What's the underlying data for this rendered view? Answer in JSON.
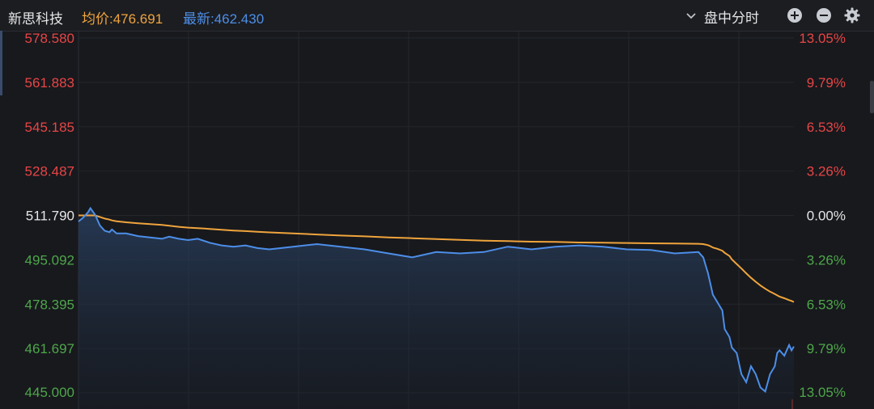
{
  "header": {
    "stock_name": "新思科技",
    "avg_price_text": "均价:476.691",
    "last_price_text": "最新:462.430",
    "mode_label": "盘中分时"
  },
  "icons": {
    "mode_dropdown": "chevron-down-icon",
    "zoom_in": "plus-circle-icon",
    "zoom_out": "minus-circle-icon",
    "settings": "gear-icon"
  },
  "colors": {
    "background": "#17191d",
    "up": "#e84545",
    "down": "#4fa64a",
    "neutral": "#e6e6e6",
    "price_line": "#4d8ee8",
    "avg_line": "#f0a43c"
  },
  "chart_data": {
    "type": "line",
    "title": "",
    "reference_price": 511.79,
    "ylim": [
      445.0,
      578.58
    ],
    "y_ticks": [
      "578.580",
      "561.883",
      "545.185",
      "528.487",
      "511.790",
      "495.092",
      "478.395",
      "461.697",
      "445.000"
    ],
    "pct_ticks": [
      "13.05%",
      "9.79%",
      "6.53%",
      "3.26%",
      "0.00%",
      "3.26%",
      "6.53%",
      "9.79%",
      "13.05%"
    ],
    "tick_sides": [
      "up",
      "up",
      "up",
      "up",
      "neutral",
      "down",
      "down",
      "down",
      "down"
    ],
    "x": [
      0,
      2,
      4,
      5,
      7,
      9,
      11,
      13,
      14,
      16,
      20,
      25,
      30,
      35,
      38,
      42,
      46,
      50,
      55,
      60,
      65,
      70,
      75,
      80,
      90,
      100,
      110,
      120,
      130,
      140,
      150,
      160,
      170,
      180,
      190,
      200,
      210,
      220,
      230,
      240,
      250,
      260,
      262,
      264,
      265,
      266,
      268,
      270,
      271,
      273,
      274,
      276,
      278,
      280,
      282,
      284,
      286,
      288,
      290,
      292,
      293,
      294,
      296,
      298,
      299,
      300
    ],
    "series": [
      {
        "values": [
          509.5,
          511.0,
          513.0,
          514.5,
          512.0,
          508.0,
          506.0,
          505.5,
          506.5,
          505.0,
          505.0,
          504.0,
          503.5,
          503.0,
          503.8,
          503.0,
          502.5,
          503.0,
          501.5,
          500.5,
          500.0,
          500.5,
          499.5,
          499.0,
          500.0,
          501.0,
          500.0,
          499.0,
          497.5,
          496.0,
          498.0,
          497.5,
          498.0,
          500.0,
          499.0,
          500.0,
          500.5,
          500.0,
          499.0,
          498.8,
          497.5,
          498.0,
          496.0,
          490.0,
          486.0,
          482.0,
          479.0,
          476.0,
          469.0,
          466.0,
          462.0,
          460.0,
          452.0,
          449.0,
          455.0,
          452.0,
          447.0,
          445.5,
          452.0,
          455.0,
          460.0,
          461.0,
          459.0,
          463.0,
          461.0,
          462.43
        ]
      },
      {
        "values": [
          511.79,
          511.79,
          511.79,
          511.79,
          511.79,
          511.2,
          510.6,
          510.2,
          509.9,
          509.6,
          509.2,
          508.8,
          508.5,
          508.2,
          507.9,
          507.5,
          507.2,
          507.0,
          506.7,
          506.4,
          506.1,
          505.9,
          505.6,
          505.4,
          505.0,
          504.6,
          504.2,
          503.9,
          503.5,
          503.2,
          502.9,
          502.6,
          502.3,
          502.1,
          501.9,
          501.8,
          501.6,
          501.5,
          501.4,
          501.3,
          501.2,
          501.1,
          501.0,
          500.6,
          500.2,
          499.7,
          499.2,
          498.5,
          497.7,
          496.5,
          495.2,
          493.5,
          491.8,
          490.0,
          488.3,
          486.8,
          485.4,
          484.2,
          483.1,
          482.2,
          481.7,
          481.2,
          480.6,
          479.9,
          479.6,
          479.2
        ]
      }
    ]
  }
}
